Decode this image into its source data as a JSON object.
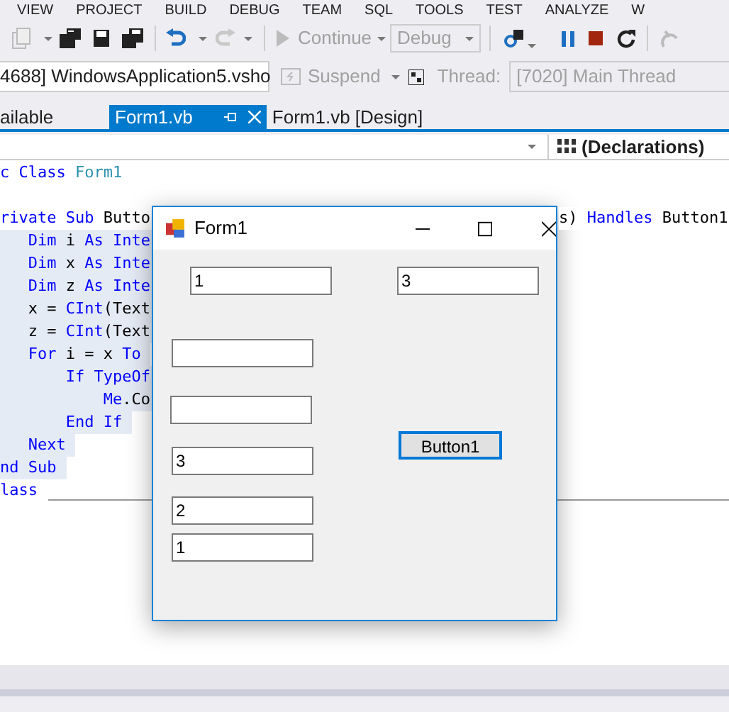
{
  "menu": [
    "VIEW",
    "PROJECT",
    "BUILD",
    "DEBUG",
    "TEAM",
    "SQL",
    "TOOLS",
    "TEST",
    "ANALYZE",
    "W"
  ],
  "toolbar": {
    "continue_label": "Continue",
    "configuration": "Debug"
  },
  "debug_location": {
    "process": "4688] WindowsApplication5.vsho",
    "suspend_label": "Suspend",
    "thread_label": "Thread:",
    "thread": "[7020] Main Thread"
  },
  "tabs": [
    {
      "label": "ailable",
      "selected": false
    },
    {
      "label": "Form1.vb",
      "selected": true
    },
    {
      "label": "Form1.vb [Design]",
      "selected": false
    }
  ],
  "navigation": {
    "members": "(Declarations)"
  },
  "code_lines": [
    {
      "selected": false,
      "segments": [
        {
          "t": "c Class ",
          "kind": "keyword"
        },
        {
          "t": "Form1",
          "kind": "type"
        }
      ]
    },
    {
      "kind": "blank"
    },
    {
      "selected": false,
      "segments": [
        {
          "t": "rivate Sub",
          "kind": "keyword"
        },
        {
          "t": " Butto"
        }
      ],
      "tail": [
        {
          "t": "s) "
        },
        {
          "t": "Handles",
          "kind": "keyword"
        },
        {
          "t": " Button1"
        }
      ]
    },
    {
      "selected": true,
      "segments": [
        {
          "t": "   Dim",
          "kind": "keyword"
        },
        {
          "t": " i "
        },
        {
          "t": "As Inte",
          "kind": "keyword"
        }
      ]
    },
    {
      "selected": true,
      "segments": [
        {
          "t": "   Dim",
          "kind": "keyword"
        },
        {
          "t": " x "
        },
        {
          "t": "As Inte",
          "kind": "keyword"
        }
      ]
    },
    {
      "selected": true,
      "segments": [
        {
          "t": "   Dim",
          "kind": "keyword"
        },
        {
          "t": " z "
        },
        {
          "t": "As Inte",
          "kind": "keyword"
        }
      ]
    },
    {
      "selected": true,
      "segments": [
        {
          "t": "   x = "
        },
        {
          "t": "CInt",
          "kind": "keyword"
        },
        {
          "t": "(Text"
        }
      ]
    },
    {
      "selected": true,
      "segments": [
        {
          "t": "   z = "
        },
        {
          "t": "CInt",
          "kind": "keyword"
        },
        {
          "t": "(Text"
        }
      ]
    },
    {
      "selected": true,
      "segments": [
        {
          "t": "   For",
          "kind": "keyword"
        },
        {
          "t": " i = x "
        },
        {
          "t": "To",
          "kind": "keyword"
        }
      ]
    },
    {
      "selected": true,
      "segments": [
        {
          "t": "       If TypeOf",
          "kind": "keyword"
        }
      ]
    },
    {
      "selected": true,
      "segments": [
        {
          "t": "           Me",
          "kind": "keyword"
        },
        {
          "t": ".Co"
        }
      ]
    },
    {
      "selected": true,
      "segments": [
        {
          "t": "       End If",
          "kind": "keyword"
        }
      ]
    },
    {
      "selected": true,
      "segments": [
        {
          "t": "   Next",
          "kind": "keyword"
        }
      ]
    },
    {
      "selected": true,
      "segments": [
        {
          "t": "nd Sub",
          "kind": "keyword"
        }
      ]
    },
    {
      "selected": false,
      "segments": [
        {
          "t": "lass",
          "kind": "keyword"
        }
      ]
    }
  ],
  "form": {
    "title": "Form1",
    "textboxes": [
      {
        "kind": "textbox",
        "value": "1"
      },
      {
        "kind": "textbox",
        "value": "3"
      },
      {
        "kind": "textbox"
      },
      {
        "kind": "textbox"
      },
      {
        "kind": "textbox",
        "value": "3"
      },
      {
        "kind": "textbox",
        "value": "2"
      },
      {
        "kind": "textbox",
        "value": "1"
      }
    ],
    "button": {
      "label": "Button1",
      "focused": true
    }
  }
}
